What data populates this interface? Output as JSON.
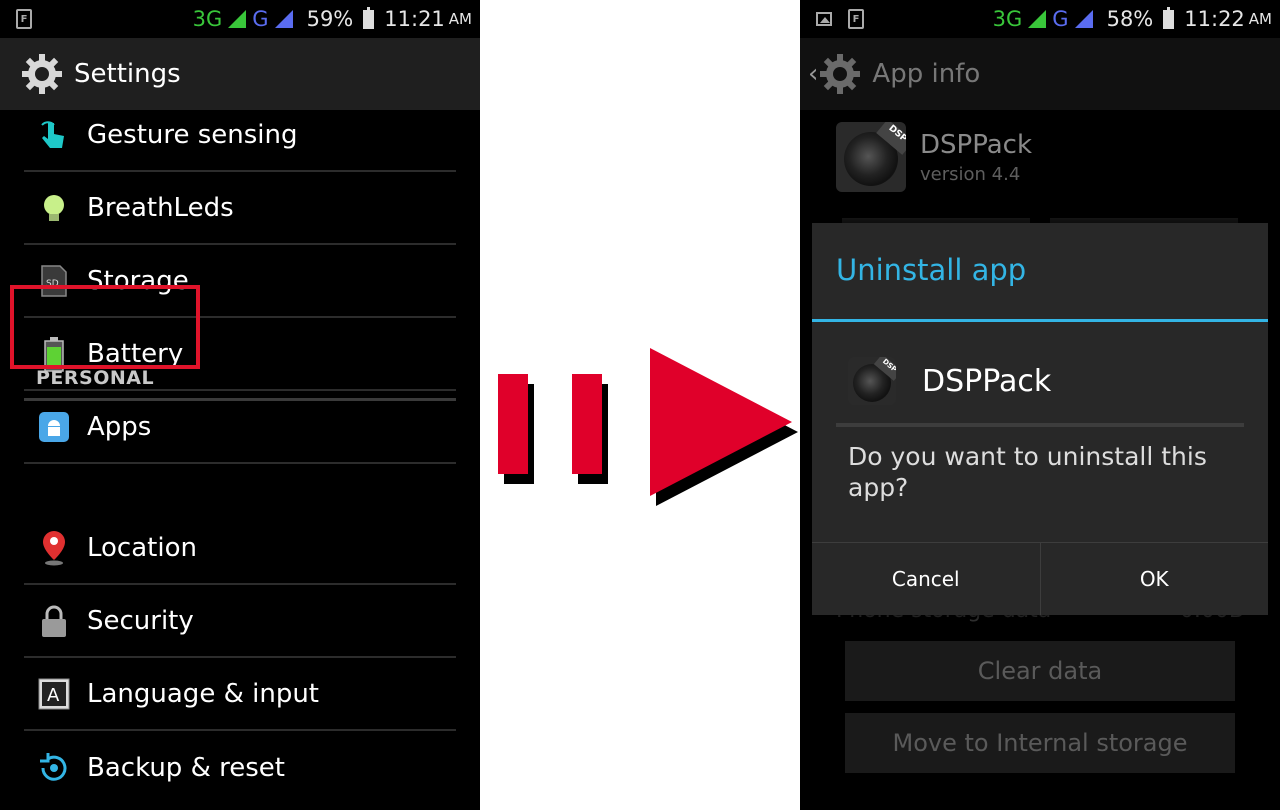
{
  "left_phone": {
    "status": {
      "net1": "3G",
      "net2": "G",
      "battery": "59%",
      "time": "11:21",
      "ampm": "AM"
    },
    "actionbar": {
      "title": "Settings",
      "icon": "gear-icon"
    },
    "items": [
      {
        "label": "Gesture sensing",
        "icon": "gesture-icon"
      },
      {
        "label": "BreathLeds",
        "icon": "lightbulb-icon"
      },
      {
        "label": "Storage",
        "icon": "sd-card-icon"
      },
      {
        "label": "Battery",
        "icon": "battery-icon"
      },
      {
        "label": "Apps",
        "icon": "android-apps-icon"
      }
    ],
    "section": "PERSONAL",
    "personal_items": [
      {
        "label": "Location",
        "icon": "location-pin-icon"
      },
      {
        "label": "Security",
        "icon": "lock-icon"
      },
      {
        "label": "Language & input",
        "icon": "keyboard-a-icon"
      },
      {
        "label": "Backup & reset",
        "icon": "backup-icon"
      }
    ]
  },
  "right_phone": {
    "status": {
      "net1": "3G",
      "net2": "G",
      "battery": "58%",
      "time": "11:22",
      "ampm": "AM"
    },
    "actionbar": {
      "title": "App info",
      "back": "‹"
    },
    "app": {
      "name": "DSPPack",
      "version": "version 4.4",
      "icon_tag": "DSP"
    },
    "background": {
      "storage_label": "Phone storage data",
      "storage_value": "0.00B",
      "clear_data": "Clear data",
      "move_storage": "Move to Internal storage"
    },
    "dialog": {
      "title": "Uninstall app",
      "app_name": "DSPPack",
      "message": "Do you want to uninstall this app?",
      "cancel": "Cancel",
      "ok": "OK"
    }
  },
  "colors": {
    "accent": "#33b5e5",
    "arrow": "#e0002a",
    "highlight": "#e0132a"
  }
}
